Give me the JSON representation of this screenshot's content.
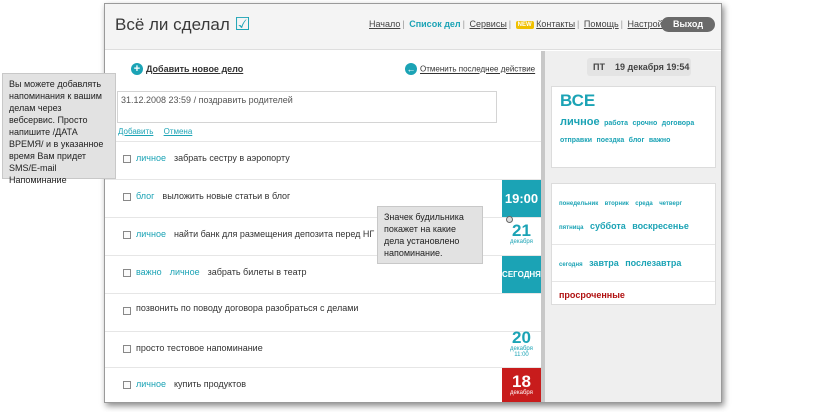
{
  "app": {
    "title": "Всё ли сделал",
    "check": "☑"
  },
  "nav": {
    "items": [
      {
        "label": "Начало",
        "active": false
      },
      {
        "label": "Список дел",
        "active": true
      },
      {
        "label": "Сервисы",
        "active": false
      },
      {
        "label": "Контакты",
        "active": false,
        "badge": "NEW"
      },
      {
        "label": "Помощь",
        "active": false
      },
      {
        "label": "Настройки",
        "active": false
      }
    ],
    "logout": "Выход"
  },
  "toolbar": {
    "add": "Добавить новое дело",
    "undo": "Отменить последнее действие"
  },
  "new_task": {
    "value": "31.12.2008 23:59 / поздравить родителей",
    "add": "Добавить",
    "cancel": "Отмена"
  },
  "tasks": [
    {
      "tags": [
        "личное"
      ],
      "text": "забрать сестру в аэропорту"
    },
    {
      "tags": [
        "блог"
      ],
      "text": "выложить новые статьи в блог",
      "badge": {
        "kind": "time",
        "value": "19:00"
      }
    },
    {
      "tags": [
        "личное"
      ],
      "text": "найти банк для размещения депозита перед НГ",
      "badge": {
        "kind": "date",
        "value": "21",
        "sub": "декабря"
      }
    },
    {
      "tags": [
        "важно",
        "личное"
      ],
      "text": "забрать билеты в театр",
      "badge": {
        "kind": "today",
        "value": "СЕГОДНЯ"
      }
    },
    {
      "tags": [],
      "text": "позвонить по поводу договора разобраться с делами"
    },
    {
      "tags": [],
      "text": "просто тестовое напоминание",
      "badge": {
        "kind": "date",
        "value": "20",
        "sub": "декабря",
        "sub2": "11:00"
      }
    },
    {
      "tags": [
        "личное"
      ],
      "text": "купить продуктов",
      "badge": {
        "kind": "overdue",
        "value": "18",
        "sub": "декабря"
      }
    }
  ],
  "sidebar": {
    "dow": "ПТ",
    "date": "19 декабря 19:54",
    "all": "ВСЕ",
    "tags_line1_big": "личное",
    "tags_line1": [
      "работа",
      "срочно",
      "договора"
    ],
    "tags_line2": [
      "отправки",
      "поездка",
      "блог",
      "важно"
    ],
    "days_small": [
      "понедельник",
      "вторник",
      "среда",
      "четверг"
    ],
    "days_line2_small": "пятница",
    "days_line2_big": [
      "суббота",
      "воскресенье"
    ],
    "today": "сегодня",
    "tomorrow": "завтра",
    "after_tomorrow": "послезавтра",
    "overdue": "просроченные"
  },
  "tooltips": {
    "left": "Вы можете добавлять напоминания к вашим делам через вебсервис. Просто напишите /ДАТА ВРЕМЯ/ и в указанное время Вам придет SMS/E-mail Напоминание",
    "alarm": "Значек будильника покажет на какие дела установлено напоминание."
  },
  "colors": {
    "accent": "#1ba3b5",
    "overdue": "#c81c1c",
    "logout": "#6a6a6a"
  }
}
